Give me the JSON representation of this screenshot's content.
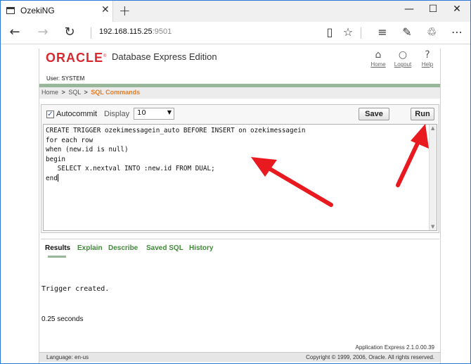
{
  "browser": {
    "tab_title": "OzekiNG",
    "new_tab_glyph": "+",
    "close_glyph": "✕",
    "address_host": "192.168.115.25",
    "address_port": ":9501",
    "window_controls": [
      "—",
      "☐",
      "✕"
    ]
  },
  "header": {
    "logo_text": "ORACLE",
    "logo_mark": "®",
    "product_name": "Database Express Edition",
    "user_label": "User: SYSTEM",
    "links": [
      {
        "label": "Home",
        "icon": "home-icon"
      },
      {
        "label": "Logout",
        "icon": "logout-icon"
      },
      {
        "label": "Help",
        "icon": "help-icon"
      }
    ]
  },
  "breadcrumb": {
    "items": [
      "Home",
      "SQL"
    ],
    "current": "SQL Commands",
    "separator": ">"
  },
  "toolbar": {
    "autocommit_label": "Autocommit",
    "autocommit_checked": true,
    "display_label": "Display",
    "display_value": "10",
    "save_label": "Save",
    "run_label": "Run"
  },
  "editor": {
    "code": "CREATE TRIGGER ozekimessagein_auto BEFORE INSERT on ozekimessagein\nfor each row\nwhen (new.id is null)\nbegin\n   SELECT x.nextval INTO :new.id FROM DUAL;\nend"
  },
  "results": {
    "tabs": [
      "Results",
      "Explain",
      "Describe",
      "Saved SQL",
      "History"
    ],
    "active_tab": "Results",
    "message": "Trigger created.",
    "elapsed": "0.25 seconds"
  },
  "footer": {
    "version": "Application Express 2.1.0.00.39",
    "language": "Language: en-us",
    "copyright": "Copyright © 1999, 2006, Oracle. All rights reserved."
  },
  "colors": {
    "oracle_red": "#d8292f",
    "breadcrumb_orange": "#e57b22",
    "tab_green": "#3f8a36",
    "annotation_red": "#e8191f"
  }
}
